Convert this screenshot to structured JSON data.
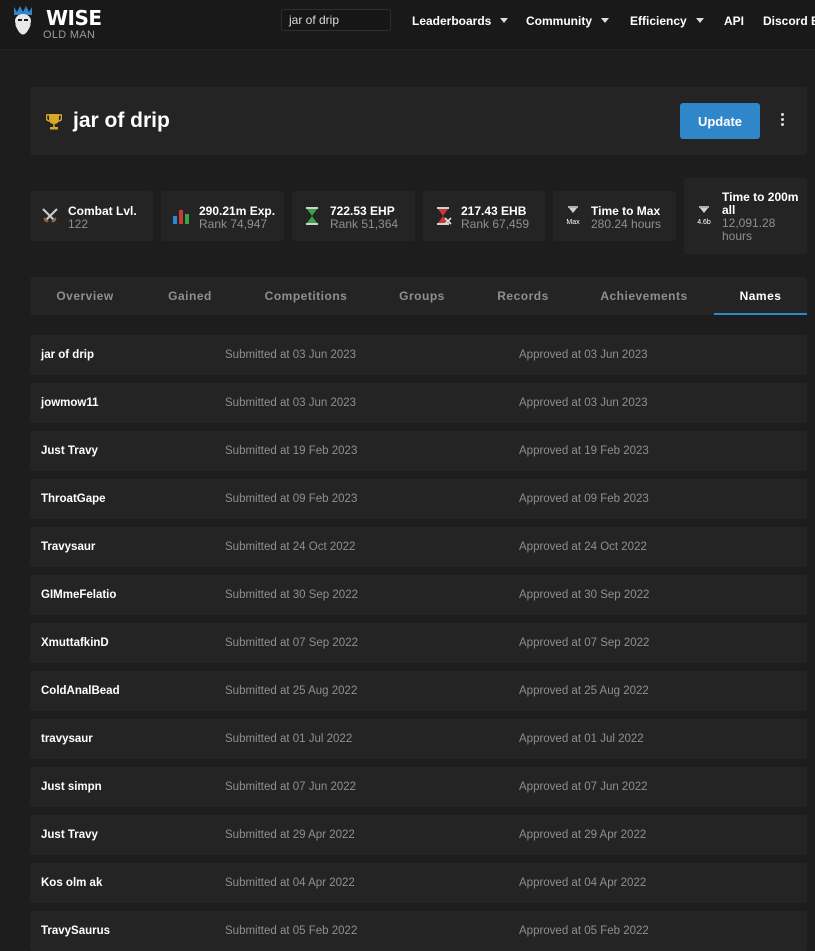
{
  "header": {
    "logo_title": "WISE",
    "logo_subtitle": "OLD MAN",
    "search_value": "jar of drip",
    "nav": [
      "Leaderboards",
      "Community",
      "Efficiency",
      "API",
      "Discord Bo"
    ]
  },
  "player": {
    "name": "jar of drip",
    "update_label": "Update"
  },
  "stats": [
    {
      "label": "Combat Lvl.",
      "sub": "122",
      "icon": "crossed-swords-icon"
    },
    {
      "label": "290.21m Exp.",
      "sub": "Rank 74,947",
      "icon": "bar-chart-icon"
    },
    {
      "label": "722.53 EHP",
      "sub": "Rank 51,364",
      "icon": "hourglass-green-icon"
    },
    {
      "label": "217.43 EHB",
      "sub": "Rank 67,459",
      "icon": "hourglass-red-icon"
    },
    {
      "label": "Time to Max",
      "sub": "280.24 hours",
      "icon": "hourglass-max-icon"
    },
    {
      "label": "Time to 200m all",
      "sub": "12,091.28 hours",
      "icon": "hourglass-200m-icon"
    }
  ],
  "stat_icon_texts": {
    "max": "Max",
    "b200": "4.6b"
  },
  "tabs": [
    "Overview",
    "Gained",
    "Competitions",
    "Groups",
    "Records",
    "Achievements",
    "Names"
  ],
  "active_tab": "Names",
  "names": [
    {
      "name": "jar of drip",
      "submitted": "Submitted at 03 Jun 2023",
      "approved": "Approved at 03 Jun 2023"
    },
    {
      "name": "jowmow11",
      "submitted": "Submitted at 03 Jun 2023",
      "approved": "Approved at 03 Jun 2023"
    },
    {
      "name": "Just Travy",
      "submitted": "Submitted at 19 Feb 2023",
      "approved": "Approved at 19 Feb 2023"
    },
    {
      "name": "ThroatGape",
      "submitted": "Submitted at 09 Feb 2023",
      "approved": "Approved at 09 Feb 2023"
    },
    {
      "name": "Travysaur",
      "submitted": "Submitted at 24 Oct 2022",
      "approved": "Approved at 24 Oct 2022"
    },
    {
      "name": "GIMmeFelatio",
      "submitted": "Submitted at 30 Sep 2022",
      "approved": "Approved at 30 Sep 2022"
    },
    {
      "name": "XmuttafkinD",
      "submitted": "Submitted at 07 Sep 2022",
      "approved": "Approved at 07 Sep 2022"
    },
    {
      "name": "ColdAnalBead",
      "submitted": "Submitted at 25 Aug 2022",
      "approved": "Approved at 25 Aug 2022"
    },
    {
      "name": "travysaur",
      "submitted": "Submitted at 01 Jul 2022",
      "approved": "Approved at 01 Jul 2022"
    },
    {
      "name": "Just simpn",
      "submitted": "Submitted at 07 Jun 2022",
      "approved": "Approved at 07 Jun 2022"
    },
    {
      "name": "Just Travy",
      "submitted": "Submitted at 29 Apr 2022",
      "approved": "Approved at 29 Apr 2022"
    },
    {
      "name": "Kos olm ak",
      "submitted": "Submitted at 04 Apr 2022",
      "approved": "Approved at 04 Apr 2022"
    },
    {
      "name": "TravySaurus",
      "submitted": "Submitted at 05 Feb 2022",
      "approved": "Approved at 05 Feb 2022"
    }
  ],
  "colors": {
    "accent": "#2f86c8",
    "background": "#1d1d1d",
    "card": "#242424",
    "muted": "#8f8f8f"
  }
}
